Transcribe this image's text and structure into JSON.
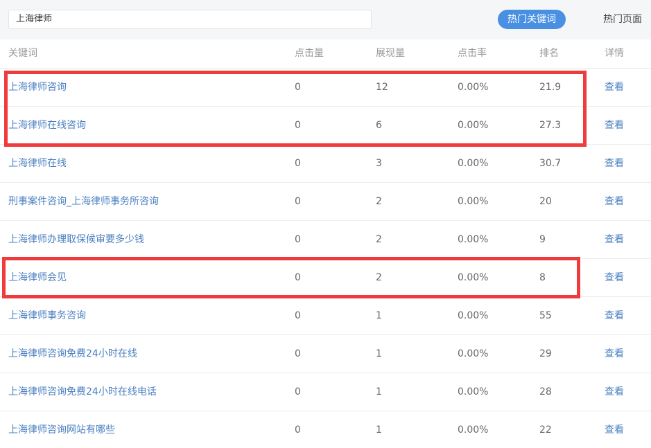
{
  "search": {
    "value": "上海律师"
  },
  "tabs": {
    "hot_keywords": "热门关键词",
    "hot_pages": "热门页面"
  },
  "table": {
    "headers": {
      "keyword": "关键词",
      "clicks": "点击量",
      "impressions": "展现量",
      "ctr": "点击率",
      "rank": "排名",
      "detail": "详情"
    },
    "rows": [
      {
        "keyword": "上海律师咨询",
        "clicks": "0",
        "impressions": "12",
        "ctr": "0.00%",
        "rank": "21.9",
        "detail": "查看"
      },
      {
        "keyword": "上海律师在线咨询",
        "clicks": "0",
        "impressions": "6",
        "ctr": "0.00%",
        "rank": "27.3",
        "detail": "查看"
      },
      {
        "keyword": "上海律师在线",
        "clicks": "0",
        "impressions": "3",
        "ctr": "0.00%",
        "rank": "30.7",
        "detail": "查看"
      },
      {
        "keyword": "刑事案件咨询_上海律师事务所咨询",
        "clicks": "0",
        "impressions": "2",
        "ctr": "0.00%",
        "rank": "20",
        "detail": "查看"
      },
      {
        "keyword": "上海律师办理取保候审要多少钱",
        "clicks": "0",
        "impressions": "2",
        "ctr": "0.00%",
        "rank": "9",
        "detail": "查看"
      },
      {
        "keyword": "上海律师会见",
        "clicks": "0",
        "impressions": "2",
        "ctr": "0.00%",
        "rank": "8",
        "detail": "查看"
      },
      {
        "keyword": "上海律师事务咨询",
        "clicks": "0",
        "impressions": "1",
        "ctr": "0.00%",
        "rank": "55",
        "detail": "查看"
      },
      {
        "keyword": "上海律师咨询免费24小时在线",
        "clicks": "0",
        "impressions": "1",
        "ctr": "0.00%",
        "rank": "29",
        "detail": "查看"
      },
      {
        "keyword": "上海律师咨询免费24小时在线电话",
        "clicks": "0",
        "impressions": "1",
        "ctr": "0.00%",
        "rank": "28",
        "detail": "查看"
      },
      {
        "keyword": "上海律师咨询网站有哪些",
        "clicks": "0",
        "impressions": "1",
        "ctr": "0.00%",
        "rank": "22",
        "detail": "查看"
      }
    ]
  },
  "colors": {
    "accent": "#4a90e2",
    "link": "#4a7fc1",
    "highlight": "#ef3b3b"
  }
}
